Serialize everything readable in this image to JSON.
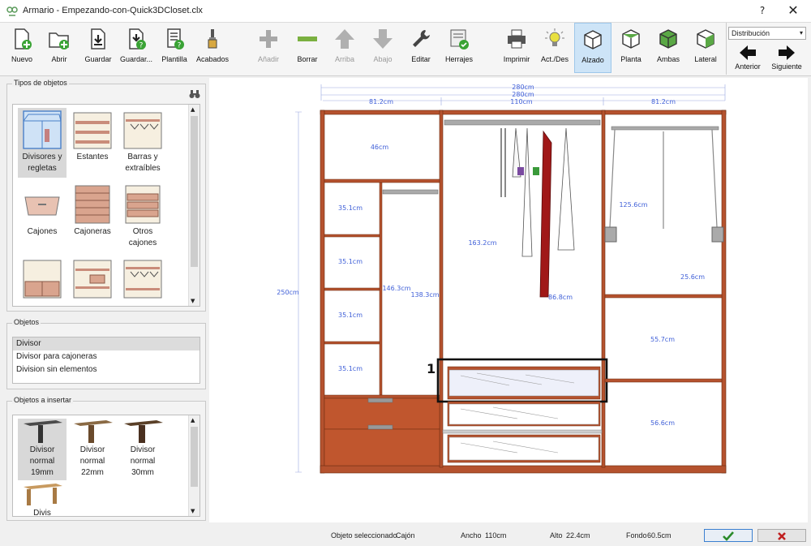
{
  "window": {
    "title": "Armario - Empezando-con-Quick3DCloset.clx",
    "help": "?",
    "close": "✕"
  },
  "toolbar": {
    "nuevo": "Nuevo",
    "abrir": "Abrir",
    "guardar": "Guardar",
    "guardar_como": "Guardar...",
    "plantilla": "Plantilla",
    "acabados": "Acabados",
    "anadir": "Añadir",
    "borrar": "Borrar",
    "arriba": "Arriba",
    "abajo": "Abajo",
    "editar": "Editar",
    "herrajes": "Herrajes",
    "imprimir": "Imprimir",
    "actdes": "Act./Des",
    "alzado": "Alzado",
    "planta": "Planta",
    "ambas": "Ambas",
    "lateral": "Lateral",
    "distribucion": "Distribución",
    "anterior": "Anterior",
    "siguiente": "Siguiente"
  },
  "tipos": {
    "title": "Tipos de objetos",
    "items": [
      "Divisores y regletas",
      "Estantes",
      "Barras y extraíbles",
      "Cajones",
      "Cajoneras",
      "Otros cajones",
      "",
      "",
      ""
    ]
  },
  "objetos": {
    "title": "Objetos",
    "items": [
      "Divisor",
      "Divisor para cajoneras",
      "Division sin elementos"
    ]
  },
  "insertar": {
    "title": "Objetos a insertar",
    "items": [
      "Divisor normal 19mm",
      "Divisor normal 22mm",
      "Divisor normal 30mm",
      "Divis"
    ]
  },
  "drawing": {
    "dims": {
      "total1": "280cm",
      "total2": "280cm",
      "left": "81.2cm",
      "mid": "110cm",
      "right": "81.2cm",
      "height": "250cm",
      "top_left": "46cm",
      "box": "35.1cm",
      "left_tall": "146.3cm",
      "left_tall2": "138.3cm",
      "center_tall": "163.2cm",
      "center_low": "86.8cm",
      "right_top": "125.6cm",
      "right_mid": "25.6cm",
      "right_lower": "55.7cm",
      "right_bottom": "56.6cm"
    },
    "callout": "1"
  },
  "status": {
    "sel_label": "Objeto seleccionado",
    "sel_value": "Cajón",
    "ancho_label": "Ancho",
    "ancho_value": "110cm",
    "alto_label": "Alto",
    "alto_value": "22.4cm",
    "fondo_label": "Fondo",
    "fondo_value": "60.5cm"
  },
  "colors": {
    "wood": "#b5522e",
    "accent": "#4060d8",
    "selection": "#000000",
    "ok": "#2a8a2a",
    "cancel": "#c02020"
  }
}
